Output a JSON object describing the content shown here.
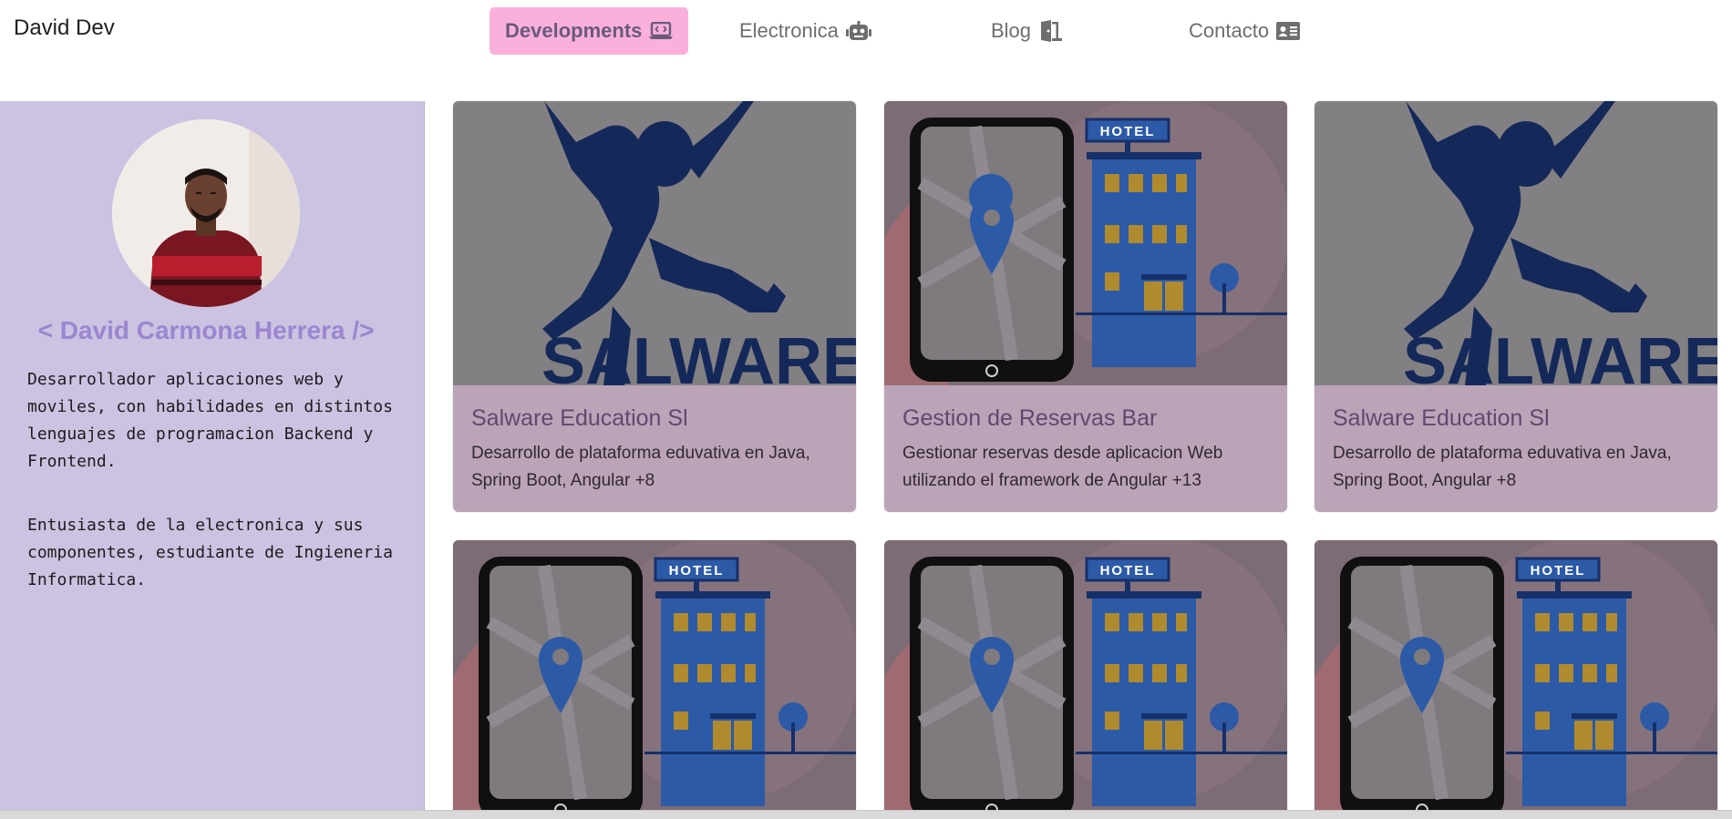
{
  "brand": "David Dev",
  "nav": [
    {
      "label": "Developments",
      "icon": "laptop-code-icon",
      "active": true
    },
    {
      "label": "Electronica",
      "icon": "robot-icon",
      "active": false
    },
    {
      "label": "Blog",
      "icon": "door-open-icon",
      "active": false
    },
    {
      "label": "Contacto",
      "icon": "address-card-icon",
      "active": false
    }
  ],
  "profile": {
    "name": "< David Carmona Herrera />",
    "bio": [
      "Desarrollador aplicaciones web y moviles, con habilidades en distintos lenguajes de programacion Backend y Frontend.",
      "Entusiasta de la electronica y sus componentes, estudiante de Ingieneria Informatica."
    ]
  },
  "cards": [
    {
      "image": "salware-logo",
      "image_text": "SALWARE",
      "title": "Salware Education Sl",
      "description": "Desarrollo de plataforma eduvativa en Java, Spring Boot, Angular +8"
    },
    {
      "image": "hotel-map-illustration",
      "image_text": "HOTEL",
      "title": "Gestion de Reservas Bar",
      "description": "Gestionar reservas desde aplicacion Web utilizando el framework de Angular +13"
    },
    {
      "image": "salware-logo",
      "image_text": "SALWARE",
      "title": "Salware Education Sl",
      "description": "Desarrollo de plataforma eduvativa en Java, Spring Boot, Angular +8"
    },
    {
      "image": "hotel-map-illustration",
      "image_text": "HOTEL"
    },
    {
      "image": "hotel-map-illustration",
      "image_text": "HOTEL"
    },
    {
      "image": "hotel-map-illustration",
      "image_text": "HOTEL"
    }
  ],
  "colors": {
    "active_nav_bg": "#fbb0dc",
    "sidebar_bg": "#ccc2e1",
    "profile_name": "#9b86d2",
    "card_bg": "#bba4b7",
    "card_title": "#5d4a6e"
  }
}
